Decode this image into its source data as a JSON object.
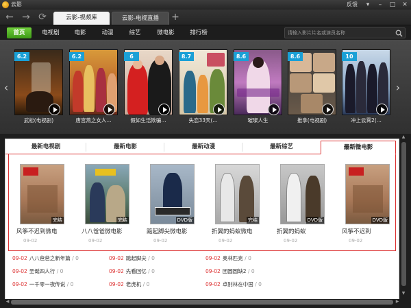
{
  "app": {
    "title": "云影",
    "feedback": "反馈",
    "window_buttons": [
      "▾",
      "–",
      "□",
      "✕"
    ]
  },
  "nav": {
    "back": "←",
    "forward": "→",
    "refresh": "⟳"
  },
  "tabs": [
    {
      "label": "云影-视频库",
      "active": true
    },
    {
      "label": "云影-电视直播",
      "active": false
    }
  ],
  "tab_add": "+",
  "menu": {
    "items": [
      "首页",
      "电视剧",
      "电影",
      "动漫",
      "综艺",
      "微电影",
      "排行榜"
    ],
    "active_index": 0
  },
  "search": {
    "placeholder": "请输入影片片名或演员名称"
  },
  "carousel": {
    "prev": "‹",
    "next": "›",
    "items": [
      {
        "score": "6.2",
        "title": "武松(电视剧)"
      },
      {
        "score": "6.2",
        "title": "唐宫燕之女人..."
      },
      {
        "score": "6",
        "title": "假如生活欺骗..."
      },
      {
        "score": "8.7",
        "title": "失恋33天(..."
      },
      {
        "score": "8.6",
        "title": "璀璨人生"
      },
      {
        "score": "8.6",
        "title": "推拿(电视剧)"
      },
      {
        "score": "10",
        "title": "冲上云霄2(..."
      }
    ]
  },
  "categories": {
    "tabs": [
      "最新电视剧",
      "最新电影",
      "最新动漫",
      "最新综艺",
      "最新微电影"
    ],
    "active_index": 4
  },
  "movies": [
    {
      "title": "风筝不迟到微电",
      "date": "09-02",
      "badge": "完结"
    },
    {
      "title": "八八爸爸微电影",
      "date": "09-02",
      "badge": "完结"
    },
    {
      "title": "踮起脚尖微电影",
      "date": "09-02",
      "badge": "DVD版"
    },
    {
      "title": "折翼的蚂蚁微电",
      "date": "09-02",
      "badge": "完结"
    },
    {
      "title": "折翼的蚂蚁",
      "date": "09-02",
      "badge": "DVD版"
    },
    {
      "title": "风筝不迟到",
      "date": "09-02",
      "badge": "DVD版"
    }
  ],
  "list": [
    {
      "date": "09-02",
      "title": "八八爸爸之新年篇",
      "count": "/ 0"
    },
    {
      "date": "09-02",
      "title": "踮起脚尖",
      "count": "/ 0"
    },
    {
      "date": "09-02",
      "title": "奥林匹克",
      "count": "/ 0"
    },
    {
      "date": "09-02",
      "title": "圣诞四人行",
      "count": "/ 0"
    },
    {
      "date": "09-02",
      "title": "先看回忆",
      "count": "/ 0"
    },
    {
      "date": "09-02",
      "title": "团圆圆缺2",
      "count": "/ 0"
    },
    {
      "date": "09-02",
      "title": "一千零一夜传说",
      "count": "/ 0"
    },
    {
      "date": "09-02",
      "title": "老虎机",
      "count": "/ 0"
    },
    {
      "date": "09-02",
      "title": "卓别林在中国",
      "count": "/ 0"
    }
  ],
  "colors": {
    "accent_green": "#4fb424",
    "score_blue": "#1aa0d6",
    "tab_red": "#dd3333"
  }
}
